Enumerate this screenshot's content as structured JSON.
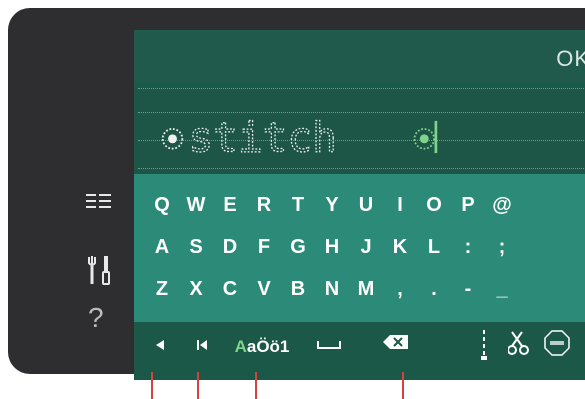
{
  "header": {
    "ok_label": "OK"
  },
  "text_field": {
    "value": "stitch"
  },
  "keyboard": {
    "row1": [
      "Q",
      "W",
      "E",
      "R",
      "T",
      "Y",
      "U",
      "I",
      "O",
      "P",
      "@"
    ],
    "row2": [
      "A",
      "S",
      "D",
      "F",
      "G",
      "H",
      "J",
      "K",
      "L",
      ":",
      ";"
    ],
    "row3": [
      "Z",
      "X",
      "C",
      "V",
      "B",
      "N",
      "M",
      ",",
      ".",
      "-",
      "_"
    ]
  },
  "bottom": {
    "charset_label": "AaÖö1",
    "charset_accent": "#7fd38b"
  },
  "side": {
    "help_label": "?"
  },
  "colors": {
    "screen_bg": "#1a5a4b",
    "keyboard_bg": "#2c8a78",
    "accent_green": "#7fd38b",
    "marker_red": "#d8413f"
  },
  "icons": {
    "left": "arrow-left-icon",
    "start": "skip-to-start-icon",
    "space": "space-icon",
    "backspace": "backspace-icon",
    "needle": "needle-icon",
    "scissors": "scissors-icon",
    "stop": "stop-icon",
    "menu": "list-menu-icon",
    "tools": "tools-icon"
  }
}
